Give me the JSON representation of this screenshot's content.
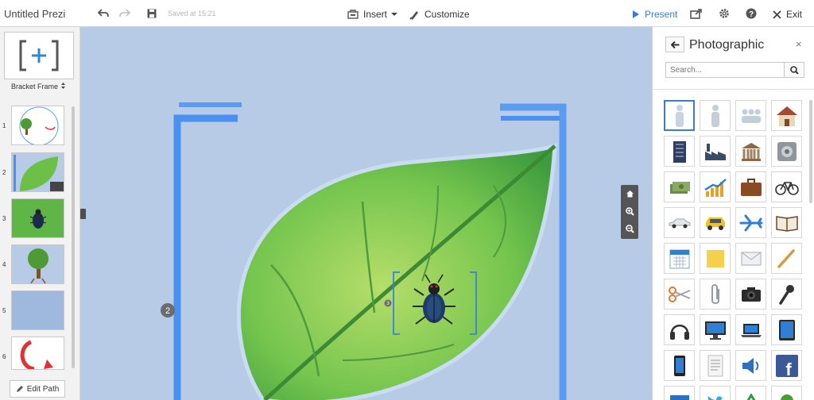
{
  "toolbar": {
    "title": "Untitled Prezi",
    "saved": "Saved at 15:21",
    "insert": "Insert",
    "customize": "Customize",
    "present": "Present",
    "exit": "Exit"
  },
  "left_panel": {
    "frame_label": "Bracket Frame",
    "slides": [
      "1",
      "2",
      "3",
      "4",
      "5",
      "6"
    ],
    "edit_path": "Edit Path"
  },
  "canvas": {
    "path_marker": "2",
    "path_marker_small": "3"
  },
  "right_panel": {
    "title": "Photographic",
    "search_placeholder": "Search...",
    "symbols": [
      "person-icon",
      "person-icon",
      "group-icon",
      "house-icon",
      "building-icon",
      "factory-icon",
      "bank-icon",
      "safe-icon",
      "money-icon",
      "growth-chart-icon",
      "briefcase-icon",
      "bicycle-icon",
      "car-icon",
      "taxi-icon",
      "airplane-icon",
      "book-icon",
      "calendar-icon",
      "sticky-note-icon",
      "envelope-icon",
      "pencil-icon",
      "scissors-icon",
      "paperclip-icon",
      "camera-icon",
      "microphone-icon",
      "headphones-icon",
      "monitor-icon",
      "laptop-icon",
      "tablet-icon",
      "phone-icon",
      "document-icon",
      "speaker-icon",
      "facebook-icon"
    ],
    "facebook_letter": "f"
  },
  "colors": {
    "accent": "#3a7bd5",
    "canvas_bg": "#b8cbe6",
    "leaf": "#6cbf47",
    "bracket": "#4a90f0"
  }
}
